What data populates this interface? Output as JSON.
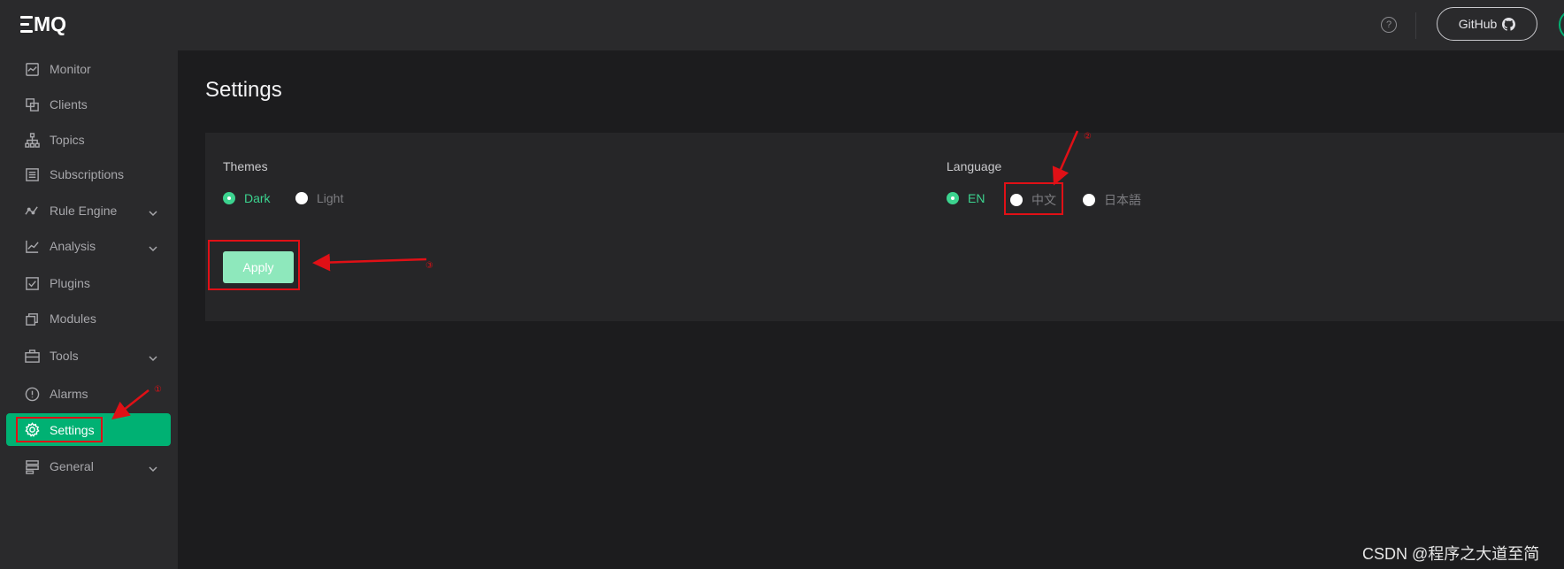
{
  "logo": {
    "text": "MQ"
  },
  "sidebar": {
    "items": [
      {
        "label": "Monitor",
        "icon": "monitor-icon"
      },
      {
        "label": "Clients",
        "icon": "clients-icon"
      },
      {
        "label": "Topics",
        "icon": "topics-icon"
      },
      {
        "label": "Subscriptions",
        "icon": "subscriptions-icon"
      },
      {
        "label": "Rule Engine",
        "icon": "rule-engine-icon",
        "expandable": true
      },
      {
        "label": "Analysis",
        "icon": "analysis-icon",
        "expandable": true
      },
      {
        "label": "Plugins",
        "icon": "plugins-icon"
      },
      {
        "label": "Modules",
        "icon": "modules-icon"
      },
      {
        "label": "Tools",
        "icon": "tools-icon",
        "expandable": true
      },
      {
        "label": "Alarms",
        "icon": "alarms-icon"
      },
      {
        "label": "Settings",
        "icon": "gear-icon",
        "active": true
      },
      {
        "label": "General",
        "icon": "general-icon",
        "expandable": true
      }
    ]
  },
  "topbar": {
    "help": "?",
    "github_label": "GitHub"
  },
  "page": {
    "title": "Settings"
  },
  "themes": {
    "label": "Themes",
    "options": [
      {
        "label": "Dark",
        "checked": true
      },
      {
        "label": "Light",
        "checked": false
      }
    ]
  },
  "language": {
    "label": "Language",
    "options": [
      {
        "label": "EN",
        "checked": true
      },
      {
        "label": "中文",
        "checked": false
      },
      {
        "label": "日本語",
        "checked": false
      }
    ]
  },
  "apply_label": "Apply",
  "annotations": {
    "step1": "①",
    "step2": "②",
    "step3": "③"
  },
  "colors": {
    "accent": "#00b173",
    "highlight": "#e01016",
    "sidebar_bg": "#2a2a2c",
    "content_bg": "#1c1c1e"
  },
  "watermark": "CSDN @程序之大道至简"
}
